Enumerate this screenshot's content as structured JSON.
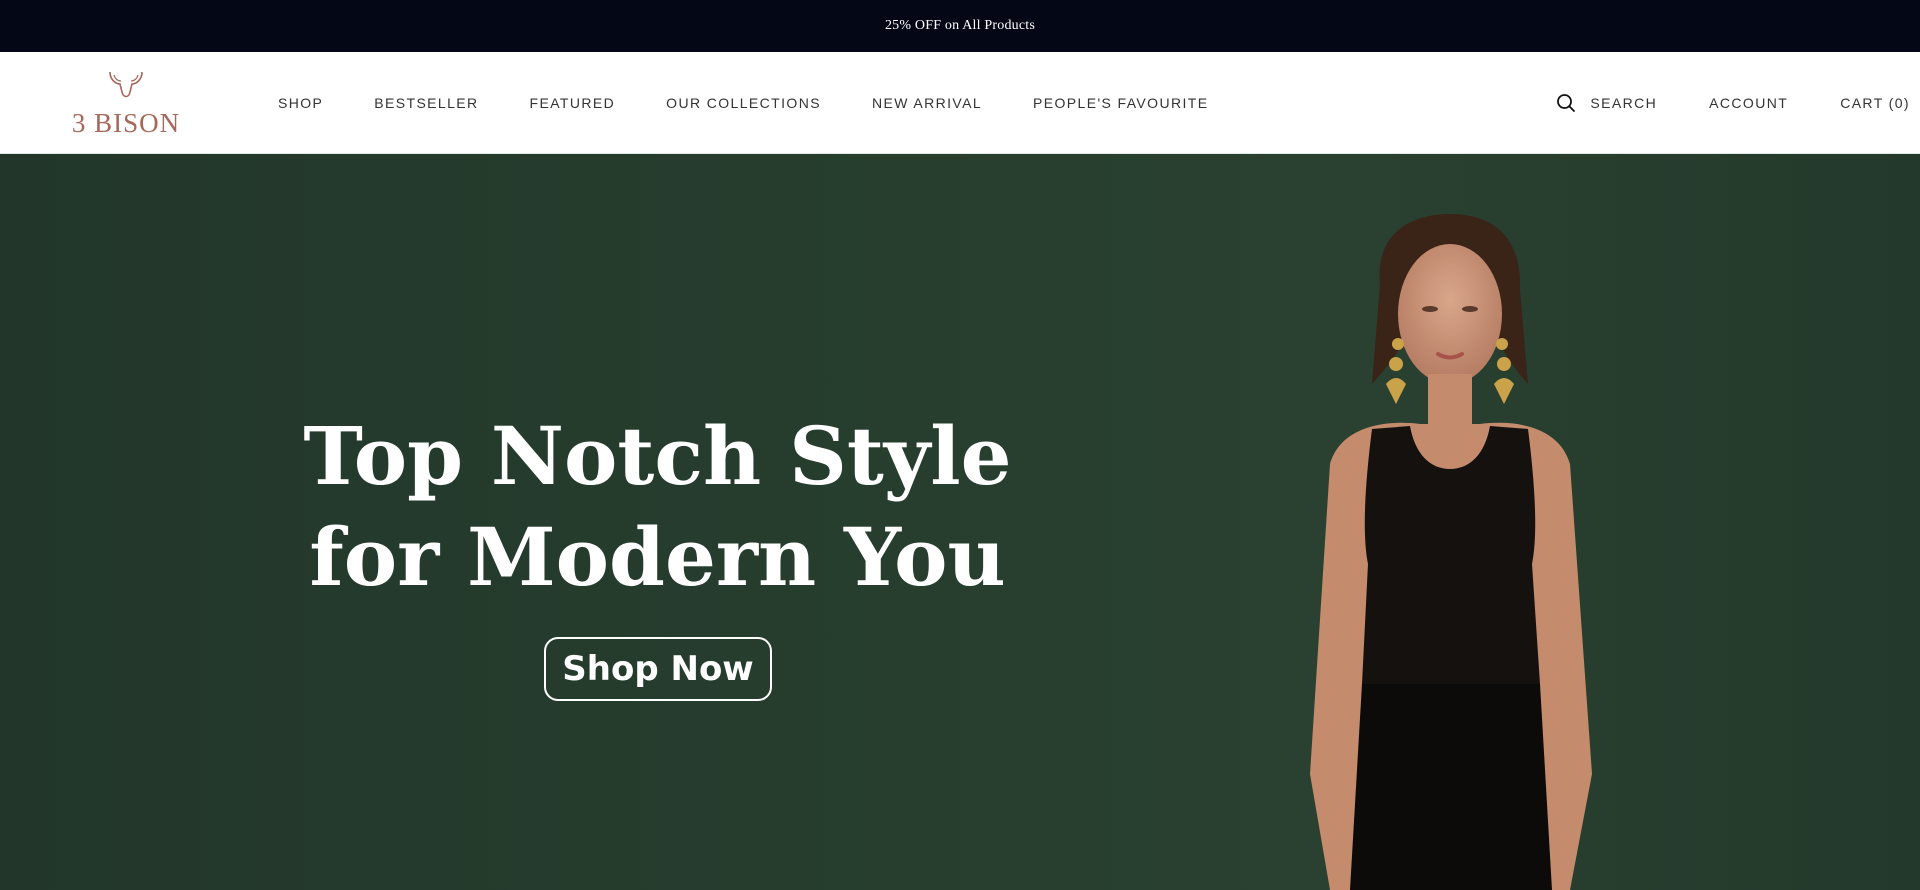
{
  "announcement": {
    "text": "25% OFF on All Products"
  },
  "brand": {
    "name": "3 BISON",
    "accent": "#a6685b"
  },
  "nav": {
    "items": [
      {
        "label": "SHOP"
      },
      {
        "label": "BESTSELLER"
      },
      {
        "label": "FEATURED"
      },
      {
        "label": "OUR COLLECTIONS"
      },
      {
        "label": "NEW ARRIVAL"
      },
      {
        "label": "PEOPLE'S FAVOURITE"
      }
    ]
  },
  "header_right": {
    "search_label": "SEARCH",
    "search_icon": "search-icon",
    "account_label": "ACCOUNT",
    "cart_label": "CART (0)"
  },
  "hero": {
    "title_line1": "Top Notch Style",
    "title_line2": "for Modern You",
    "cta_label": "Shop Now",
    "background": "#263d2e"
  }
}
